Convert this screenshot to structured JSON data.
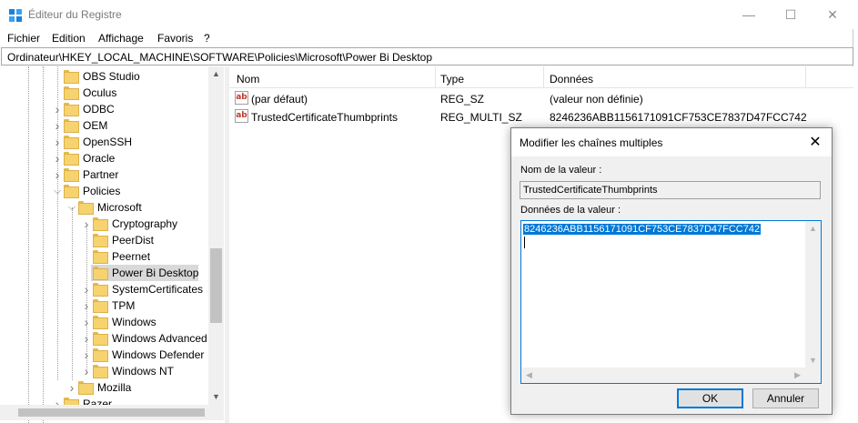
{
  "window": {
    "title": "Éditeur du Registre",
    "controls": {
      "minimize": "—",
      "maximize": "☐",
      "close": "✕"
    }
  },
  "menu": [
    "Fichier",
    "Edition",
    "Affichage",
    "Favoris",
    "?"
  ],
  "address": "Ordinateur\\HKEY_LOCAL_MACHINE\\SOFTWARE\\Policies\\Microsoft\\Power Bi Desktop",
  "tree": [
    {
      "label": "OBS Studio",
      "expander": false,
      "depth": 0
    },
    {
      "label": "Oculus",
      "expander": false,
      "depth": 0
    },
    {
      "label": "ODBC",
      "expander": "collapsed",
      "depth": 0
    },
    {
      "label": "OEM",
      "expander": "collapsed",
      "depth": 0
    },
    {
      "label": "OpenSSH",
      "expander": "collapsed",
      "depth": 0
    },
    {
      "label": "Oracle",
      "expander": "collapsed",
      "depth": 0
    },
    {
      "label": "Partner",
      "expander": "collapsed",
      "depth": 0
    },
    {
      "label": "Policies",
      "expander": "expanded",
      "depth": 0
    },
    {
      "label": "Microsoft",
      "expander": "expanded",
      "depth": 1
    },
    {
      "label": "Cryptography",
      "expander": "collapsed",
      "depth": 2
    },
    {
      "label": "PeerDist",
      "expander": false,
      "depth": 2
    },
    {
      "label": "Peernet",
      "expander": false,
      "depth": 2
    },
    {
      "label": "Power Bi Desktop",
      "expander": false,
      "depth": 2,
      "selected": true
    },
    {
      "label": "SystemCertificates",
      "expander": "collapsed",
      "depth": 2
    },
    {
      "label": "TPM",
      "expander": "collapsed",
      "depth": 2
    },
    {
      "label": "Windows",
      "expander": "collapsed",
      "depth": 2
    },
    {
      "label": "Windows Advanced",
      "expander": "collapsed",
      "depth": 2
    },
    {
      "label": "Windows Defender",
      "expander": "collapsed",
      "depth": 2
    },
    {
      "label": "Windows NT",
      "expander": "collapsed",
      "depth": 2
    },
    {
      "label": "Mozilla",
      "expander": "collapsed",
      "depth": 1
    },
    {
      "label": "Razer",
      "expander": "collapsed",
      "depth": 0
    }
  ],
  "list": {
    "columns": [
      "Nom",
      "Type",
      "Données"
    ],
    "rows": [
      {
        "icon": "ab",
        "name": "(par défaut)",
        "type": "REG_SZ",
        "data": "(valeur non définie)"
      },
      {
        "icon": "ab",
        "name": "TrustedCertificateThumbprints",
        "type": "REG_MULTI_SZ",
        "data": "8246236ABB1156171091CF753CE7837D47FCC742"
      }
    ]
  },
  "dialog": {
    "title": "Modifier les chaînes multiples",
    "close": "✕",
    "name_label": "Nom de la valeur :",
    "name_value": "TrustedCertificateThumbprints",
    "data_label": "Données de la valeur :",
    "data_value": "8246236ABB1156171091CF753CE7837D47FCC742",
    "ok": "OK",
    "cancel": "Annuler"
  },
  "colors": {
    "selection": "#0078d7",
    "folder": "#f6d36f",
    "tree_selected": "#d9d9d9"
  }
}
